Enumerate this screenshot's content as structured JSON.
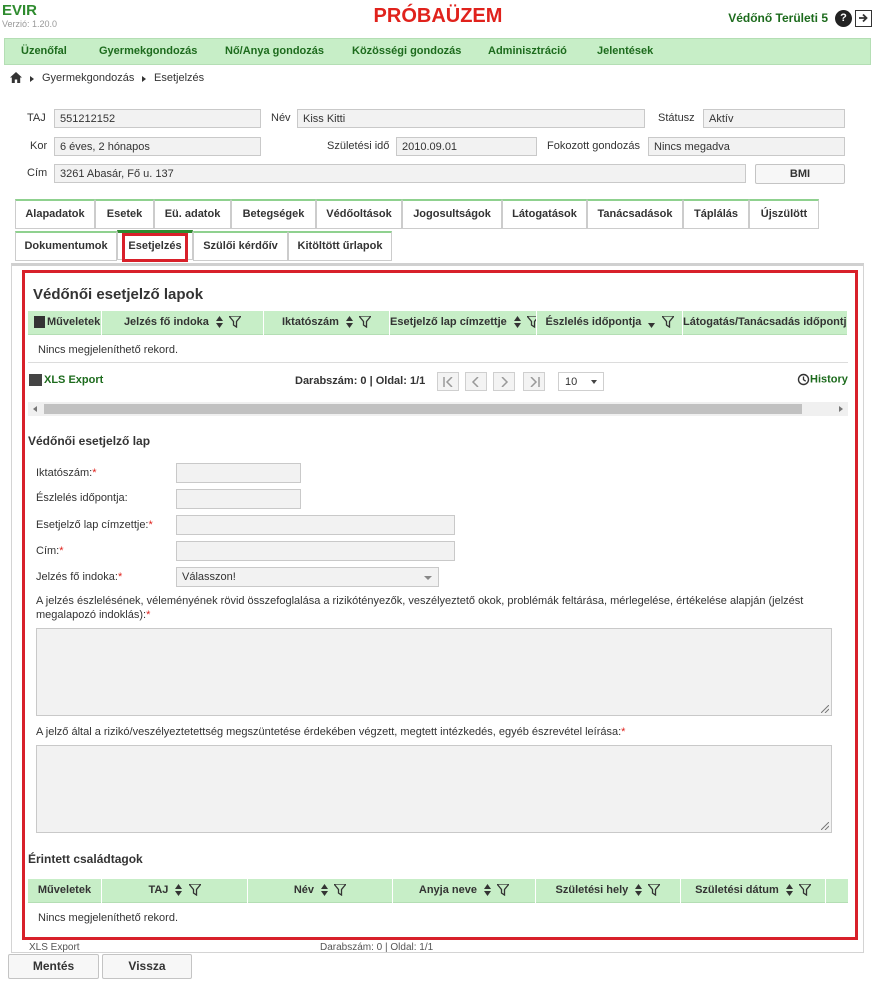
{
  "app": {
    "name": "EVIR",
    "version": "Verzió: 1.20.0",
    "env_banner": "PRÓBAÜZEM",
    "user": "Védőnő Területi 5",
    "help": "?"
  },
  "menu": [
    "Üzenőfal",
    "Gyermekgondozás",
    "Nő/Anya gondozás",
    "Közösségi gondozás",
    "Adminisztráció",
    "Jelentések"
  ],
  "breadcrumb": [
    "Gyermekgondozás",
    "Esetjelzés"
  ],
  "patient": {
    "taj_label": "TAJ",
    "taj": "551212152",
    "nev_label": "Név",
    "nev": "Kiss Kitti",
    "statusz_label": "Státusz",
    "statusz": "Aktív",
    "kor_label": "Kor",
    "kor": "6 éves, 2 hónapos",
    "szul_label": "Születési idő",
    "szul": "2010.09.01",
    "fokozott_label": "Fokozott gondozás",
    "fokozott": "Nincs megadva",
    "cim_label": "Cím",
    "cim": "3261 Abasár, Fő u. 137",
    "bmi": "BMI"
  },
  "tabs_row1": [
    "Alapadatok",
    "Esetek",
    "Eü. adatok",
    "Betegségek",
    "Védőoltások",
    "Jogosultságok",
    "Látogatások",
    "Tanácsadások",
    "Táplálás",
    "Újszülött"
  ],
  "tabs_row2": [
    "Dokumentumok",
    "Esetjelzés",
    "Szülői kérdőív",
    "Kitöltött űrlapok"
  ],
  "list": {
    "title": "Védőnői esetjelző lapok",
    "columns": [
      "Műveletek",
      "Jelzés fő indoka",
      "Iktatószám",
      "Esetjelző lap címzettje",
      "Észlelés időpontja",
      "Látogatás/Tanácsadás időpontja"
    ],
    "empty": "Nincs megjeleníthető rekord.",
    "xls": "XLS Export",
    "count": "Darabszám: 0 | Oldal: 1/1",
    "page_size": "10",
    "history": "History"
  },
  "form": {
    "title": "Védőnői esetjelző lap",
    "iktato": "Iktatószám:",
    "eszleles": "Észlelés időpontja:",
    "cimzett": "Esetjelző lap címzettje:",
    "cim": "Cím:",
    "indok": "Jelzés fő indoka:",
    "indok_value": "Válasszon!",
    "osszefoglalas": "A jelzés észlelésének, véleményének rövid összefoglalása a rizikótényezők, veszélyeztető okok, problémák feltárása, mérlegelése, értékelése alapján (jelzést megalapozó indoklás):",
    "intezkedes": "A jelző által a rizikó/veszélyeztetettség megszüntetése érdekében végzett, megtett intézkedés, egyéb észrevétel leírása:",
    "required": "*"
  },
  "family": {
    "title": "Érintett családtagok",
    "columns": [
      "Műveletek",
      "TAJ",
      "Név",
      "Anyja neve",
      "Születési hely",
      "Születési dátum"
    ],
    "empty": "Nincs megjeleníthető rekord.",
    "ghost_xls": "XLS Export",
    "ghost_count": "Darabszám: 0 | Oldal: 1/1"
  },
  "footer": {
    "save": "Mentés",
    "back": "Vissza"
  },
  "colors": {
    "green": "#2e8b2e",
    "menu_bg": "#c7eec7",
    "highlight": "#d8202a"
  }
}
